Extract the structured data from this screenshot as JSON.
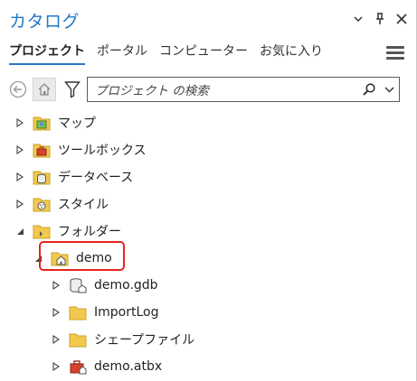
{
  "title": "カタログ",
  "colors": {
    "accent": "#2478c6",
    "folder": "#f2c94c",
    "highlight": "#e5241f"
  },
  "tabs": [
    {
      "label": "プロジェクト",
      "active": true
    },
    {
      "label": "ポータル",
      "active": false
    },
    {
      "label": "コンピューター",
      "active": false
    },
    {
      "label": "お気に入り",
      "active": false
    }
  ],
  "search": {
    "placeholder": "プロジェクト の検索"
  },
  "tree": [
    {
      "label": "マップ",
      "icon": "maps-folder-icon",
      "expanded": false
    },
    {
      "label": "ツールボックス",
      "icon": "toolbox-folder-icon",
      "expanded": false
    },
    {
      "label": "データベース",
      "icon": "database-folder-icon",
      "expanded": false
    },
    {
      "label": "スタイル",
      "icon": "style-folder-icon",
      "expanded": false
    },
    {
      "label": "フォルダー",
      "icon": "folder-icon",
      "expanded": true
    },
    {
      "label": "demo",
      "icon": "home-folder-icon",
      "expanded": true,
      "highlighted": true
    },
    {
      "label": "demo.gdb",
      "icon": "geodatabase-icon",
      "expanded": false
    },
    {
      "label": "ImportLog",
      "icon": "folder-icon",
      "expanded": false
    },
    {
      "label": "シェープファイル",
      "icon": "folder-icon",
      "expanded": false
    },
    {
      "label": "demo.atbx",
      "icon": "toolbox-icon",
      "expanded": false
    }
  ]
}
